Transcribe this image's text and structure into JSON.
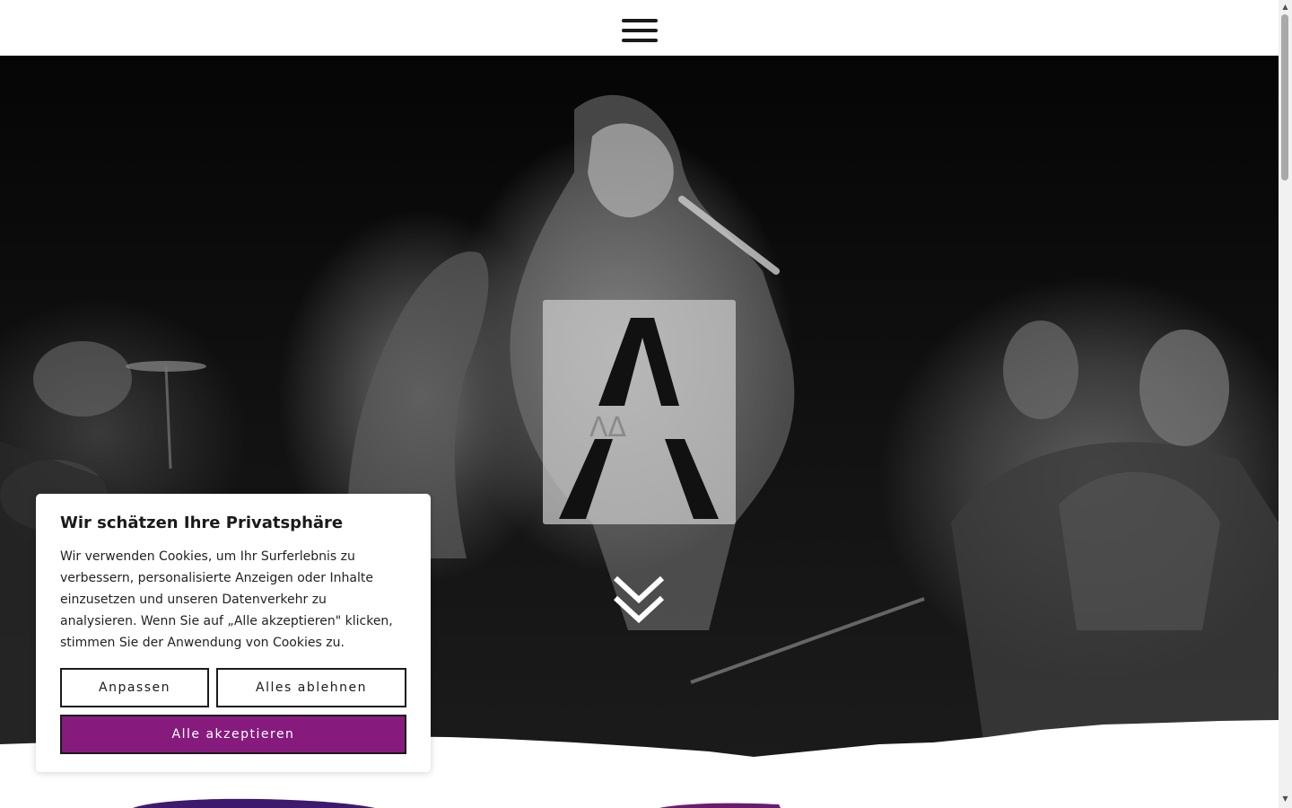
{
  "header": {
    "menu_icon": "hamburger-menu-icon"
  },
  "hero": {
    "logo_letter": "A",
    "scroll_icon": "double-chevron-down-icon"
  },
  "cookie_banner": {
    "title": "Wir schätzen Ihre Privatsphäre",
    "text": "Wir verwenden Cookies, um Ihr Surferlebnis zu verbessern, personalisierte Anzeigen oder Inhalte einzusetzen und unseren Datenverkehr zu analysieren. Wenn Sie auf „Alle akzeptieren\" klicken, stimmen Sie der Anwendung von Cookies zu.",
    "customize_label": "Anpassen",
    "reject_label": "Alles ablehnen",
    "accept_label": "Alle akzeptieren"
  },
  "colors": {
    "accent": "#861b7d",
    "stroke_left": "#3d1a6e",
    "stroke_right": "#6a1c6e"
  }
}
